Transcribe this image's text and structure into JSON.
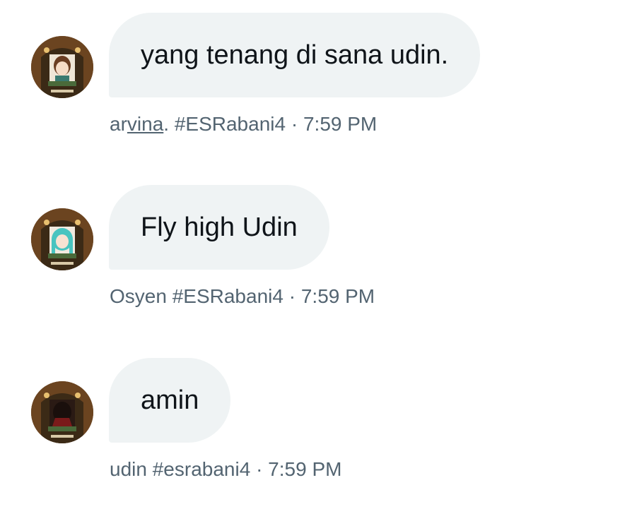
{
  "messages": [
    {
      "text": "yang tenang di sana udin.",
      "sender_prefix": "ar",
      "sender_underlined": "vina",
      "sender_suffix": ".",
      "tag": "#ESRabani4",
      "separator": "·",
      "time": "7:59 PM",
      "avatar_icon": "anime-girl-brown-hair-avatar-icon"
    },
    {
      "text": "Fly high Udin",
      "sender": "Osyen",
      "tag": "#ESRabani4",
      "separator": "·",
      "time": "7:59 PM",
      "avatar_icon": "anime-girl-teal-hair-avatar-icon"
    },
    {
      "text": "amin",
      "sender": "udin",
      "tag": "#esrabani4",
      "separator": "·",
      "time": "7:59 PM",
      "avatar_icon": "dark-hooded-figure-avatar-icon"
    }
  ],
  "colors": {
    "bubble_bg": "#eff3f4",
    "message_text": "#0f1419",
    "meta_text": "#536471",
    "avatar_frame": "#6b4420"
  }
}
